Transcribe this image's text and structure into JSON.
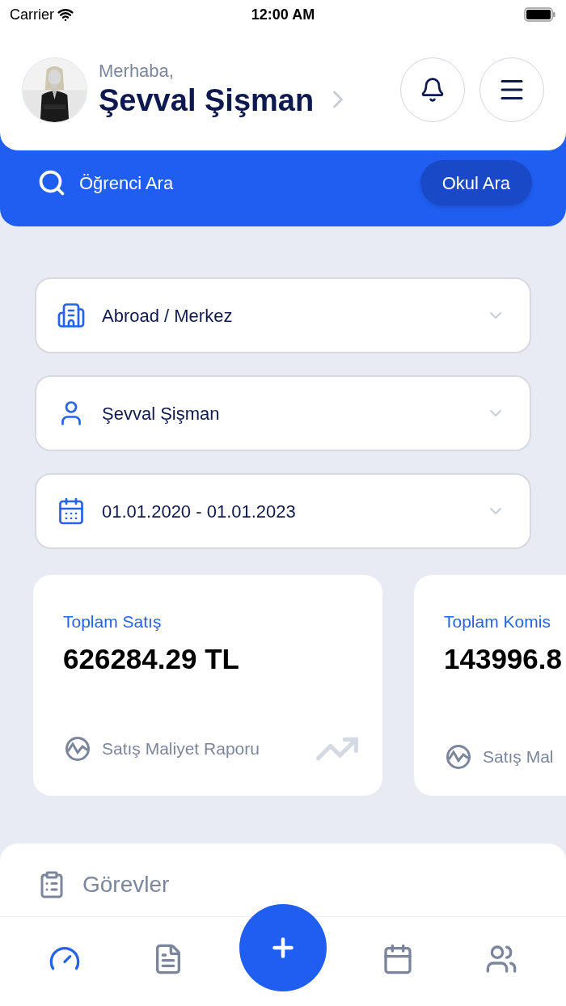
{
  "status_bar": {
    "carrier": "Carrier",
    "time": "12:00 AM"
  },
  "header": {
    "greeting": "Merhaba,",
    "name": "Şevval Şişman"
  },
  "search": {
    "placeholder": "Öğrenci Ara",
    "button": "Okul Ara"
  },
  "filters": [
    {
      "kind": "building",
      "value": "Abroad / Merkez"
    },
    {
      "kind": "person",
      "value": "Şevval Şişman"
    },
    {
      "kind": "calendar",
      "value": "01.01.2020 - 01.01.2023"
    }
  ],
  "cards": [
    {
      "kind": "full",
      "title": "Toplam Satış",
      "value": "626284.29 TL",
      "link": "Satış Maliyet Raporu"
    },
    {
      "kind": "partial",
      "title": "Toplam Komis",
      "value": "143996.8",
      "link": "Satış Mal"
    }
  ],
  "tasks": {
    "title": "Görevler"
  },
  "nav": [
    {
      "kind": "tab",
      "selected": true
    },
    {
      "kind": "tab",
      "selected": false
    },
    {
      "kind": "fab"
    },
    {
      "kind": "tab",
      "selected": false
    },
    {
      "kind": "tab",
      "selected": false
    }
  ]
}
